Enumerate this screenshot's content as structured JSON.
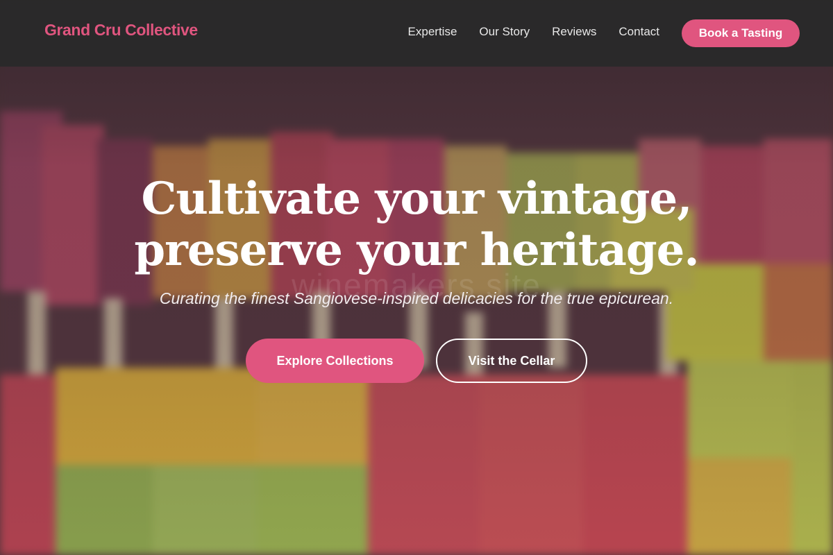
{
  "nav": {
    "brand": "Grand Cru Collective",
    "links": [
      "Expertise",
      "Our Story",
      "Reviews",
      "Contact"
    ],
    "cta": "Book a Tasting"
  },
  "hero": {
    "title_line1": "Cultivate your vintage,",
    "title_line2": "preserve your heritage.",
    "subtitle": "Curating the finest Sangiovese-inspired delicacies for the true epicurean.",
    "primary_button": "Explore Collections",
    "secondary_button": "Visit the Cellar",
    "watermark": "winemakers site"
  },
  "colors": {
    "accent": "#e0557f",
    "navbar": "#2a2a2a",
    "text": "#ffffff"
  }
}
